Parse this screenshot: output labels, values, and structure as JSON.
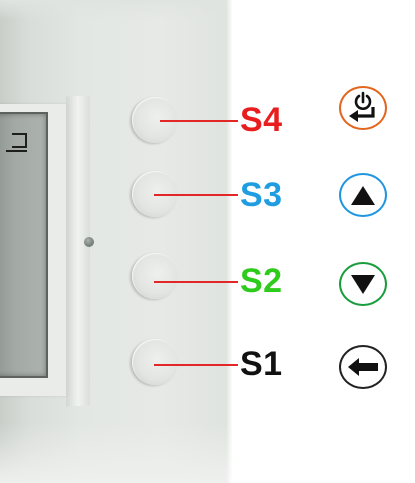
{
  "keys": [
    {
      "id": "s4",
      "label": "S4",
      "color": "#e81e1e",
      "function_icon": "power-enter-icon",
      "ring_color": "#e3661f"
    },
    {
      "id": "s3",
      "label": "S3",
      "color": "#1f9de0",
      "function_icon": "arrow-up-icon",
      "ring_color": "#2196e0"
    },
    {
      "id": "s2",
      "label": "S2",
      "color": "#2fcb1c",
      "function_icon": "arrow-down-icon",
      "ring_color": "#1a9d3c"
    },
    {
      "id": "s1",
      "label": "S1",
      "color": "#111111",
      "function_icon": "arrow-left-icon",
      "ring_color": "#222222"
    }
  ],
  "connector_color": "#e32626"
}
